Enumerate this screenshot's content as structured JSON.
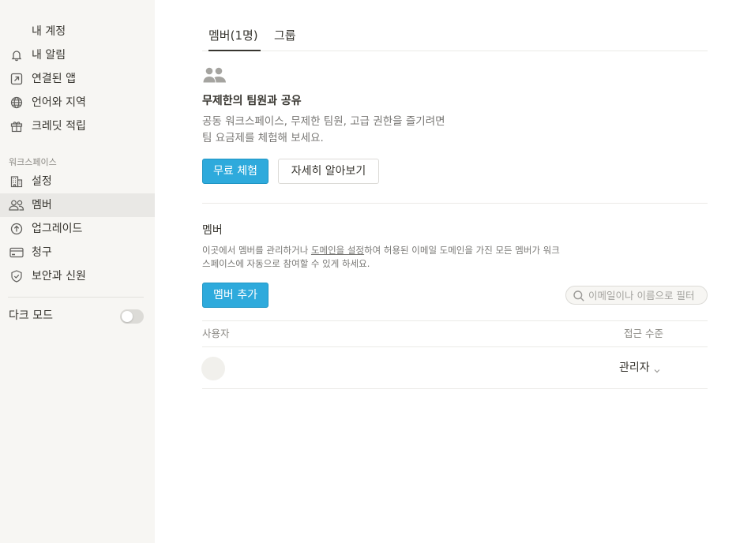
{
  "sidebar": {
    "items": [
      {
        "label": "내 계정",
        "icon": "none"
      },
      {
        "label": "내 알림",
        "icon": "bell-icon"
      },
      {
        "label": "연결된 앱",
        "icon": "arrow-up-right-icon"
      },
      {
        "label": "언어와 지역",
        "icon": "globe-icon"
      },
      {
        "label": "크레딧 적립",
        "icon": "gift-icon"
      }
    ],
    "workspace_section_label": "워크스페이스",
    "workspace_items": [
      {
        "label": "설정",
        "icon": "building-icon"
      },
      {
        "label": "멤버",
        "icon": "people-icon",
        "active": true
      },
      {
        "label": "업그레이드",
        "icon": "arrow-up-circle-icon"
      },
      {
        "label": "청구",
        "icon": "credit-card-icon"
      },
      {
        "label": "보안과 신원",
        "icon": "shield-check-icon"
      }
    ],
    "dark_mode_label": "다크 모드",
    "dark_mode_on": false
  },
  "tabs": [
    {
      "label": "멤버(1명)",
      "active": true
    },
    {
      "label": "그룹",
      "active": false
    }
  ],
  "promo": {
    "icon": "people-icon",
    "title": "무제한의 팀원과 공유",
    "description_line1": "공동 워크스페이스, 무제한 팀원, 고급 권한을 즐기려면",
    "description_line2": "팀 요금제를 체험해 보세요.",
    "trial_button": "무료 체험",
    "learn_more_button": "자세히 알아보기"
  },
  "members": {
    "title": "멤버",
    "desc_part1": "이곳에서 멤버를 관리하거나 ",
    "desc_link": "도메인을 설정",
    "desc_part2": "하여 허용된 이메일 도메인을 가진 모든 멤버가 워크",
    "desc_part3": "스페이스에 자동으로 참여할 수 있게 하세요.",
    "add_button": "멤버 추가",
    "search_placeholder": "이메일이나 이름으로 필터",
    "columns": {
      "user": "사용자",
      "access": "접근 수준"
    },
    "rows": [
      {
        "user": "",
        "access": "관리자"
      }
    ]
  },
  "colors": {
    "accent": "#2eaadc",
    "sidebar_bg": "#f7f6f3",
    "active_item_bg": "#e9e8e5",
    "text": "#37352f",
    "muted": "#787774"
  }
}
